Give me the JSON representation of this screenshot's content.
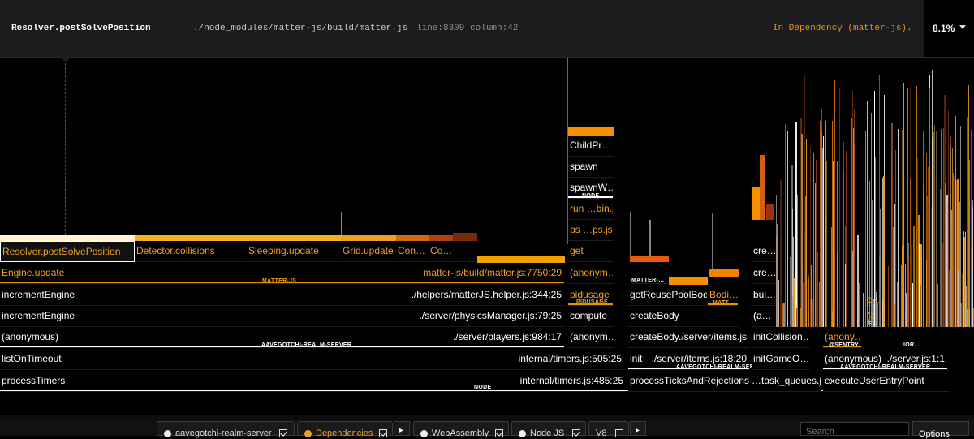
{
  "header": {
    "function_name": "Resolver.postSolvePosition",
    "file_path": "./node_modules/matter-js/build/matter.js",
    "location": "line:8309 column:42",
    "dependency_label": "In Dependency  (matter-js).",
    "percentage": "8.1%"
  },
  "colors": {
    "dependency": "#e89000",
    "dependency_text": "#f0a020",
    "background": "#000000",
    "header_bg": "#1c1c1e"
  },
  "frames": {
    "resolver": "Resolver.postSolvePosition",
    "detector": "Detector.collisions",
    "sleeping": "Sleeping.update",
    "grid": "Grid.update",
    "con1": "Con…",
    "con2": "Co…",
    "engine_update": "Engine.update",
    "engine_update_path": "matter-js/build/matter.js:7750:29",
    "pkg_matterjs": "MATTER-JS",
    "increment1": "incrementEngine",
    "increment1_path": "./helpers/matterJS.helper.js:344:25",
    "increment2": "incrementEngine",
    "increment2_path": "./server/physicsManager.js:79:25",
    "anon_players": "(anonymous)",
    "anon_players_path": "./server/players.js:984:17",
    "pkg_realm1": "AAVEGOTCHI-REALM-SERVER",
    "list_on_timeout": "listOnTimeout",
    "list_on_timeout_path": "internal/timers.js:505:25",
    "process_timers": "processTimers",
    "process_timers_path": "internal/timers.js:485:25",
    "pkg_node1": "NODE",
    "child_pr": "ChildPr…",
    "spawn": "spawn",
    "spawn_w": "spawnW…",
    "pkg_node2": "NODE",
    "run_bin": "run …bin.js",
    "ps": "ps …ps.js",
    "get": "get",
    "anon1": "(anonym…",
    "pidusage": "pidusage",
    "pkg_pidusage": "PIDUSAGE",
    "compute": "compute",
    "anon2": "(anonym…",
    "pkg_matter2": "MATTER-…",
    "get_reuse": "getReusePoolBody",
    "bodi": "Bodi…",
    "pkg_matt": "MATT…",
    "create_body1": "createBody",
    "create_body2": "createBody",
    "create_body2_path": "./server/items.js",
    "init": "init",
    "init_path": "./server/items.js:18:20",
    "pkg_realm2": "AAVEGOTCHI-REALM-SERVER",
    "process_ticks": "processTicksAndRejections",
    "task_queues": "…task_queues.js",
    "cre1": "cre…",
    "cre2": "cre…",
    "bui": "bui…",
    "anon_a": "(a…",
    "init_collision": "initCollision…",
    "init_game": "initGameO…",
    "anon_sentry": "(anony…",
    "pkg_sentry": "@SENTRY",
    "ch": "CH…",
    "anon_ex": "(a…",
    "pkg_ex": "EX…",
    "pkg_ior": "IOR…",
    "anon_server": "(anonymous)",
    "anon_server_path": "./server.js:1:1",
    "pkg_realm3": "AAVEGOTCHI-REALM-SERVER",
    "execute_user": "executeUserEntryPoint"
  },
  "footer": {
    "categories": [
      {
        "label": "aavegotchi-realm-server",
        "checked": true
      },
      {
        "label": "Dependencies",
        "checked": true
      },
      {
        "label": "WebAssembly",
        "checked": true
      },
      {
        "label": "Node JS",
        "checked": true
      },
      {
        "label": "V8",
        "checked": false
      }
    ],
    "search_placeholder": "Search",
    "options_label": "Options"
  }
}
